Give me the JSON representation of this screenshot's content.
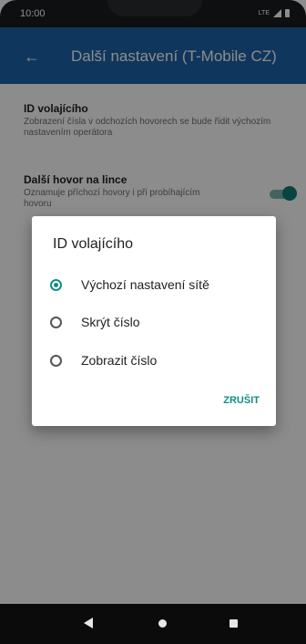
{
  "status_bar": {
    "time": "10:00",
    "network": "LTE"
  },
  "app_bar": {
    "title": "Další nastavení (T-Mobile CZ)"
  },
  "settings": [
    {
      "title": "ID volajícího",
      "summary": "Zobrazení čísla v odchozích hovorech se bude řídit výchozím nastavením operátora"
    },
    {
      "title": "Další hovor na lince",
      "summary": "Oznamuje příchozí hovory i při probíhajícím hovoru",
      "toggle_on": true
    }
  ],
  "dialog": {
    "title": "ID volajícího",
    "options": [
      {
        "label": "Výchozí nastavení sítě",
        "selected": true
      },
      {
        "label": "Skrýt číslo",
        "selected": false
      },
      {
        "label": "Zobrazit číslo",
        "selected": false
      }
    ],
    "cancel_label": "ZRUŠIT"
  },
  "colors": {
    "app_bar": "#1d63a8",
    "accent": "#0e8f84",
    "scrim": "rgba(0,0,0,0.45)"
  },
  "icons": {
    "back": "arrow-left-icon",
    "nav_back": "triangle-back-icon",
    "nav_home": "circle-home-icon",
    "nav_recent": "square-recents-icon"
  }
}
